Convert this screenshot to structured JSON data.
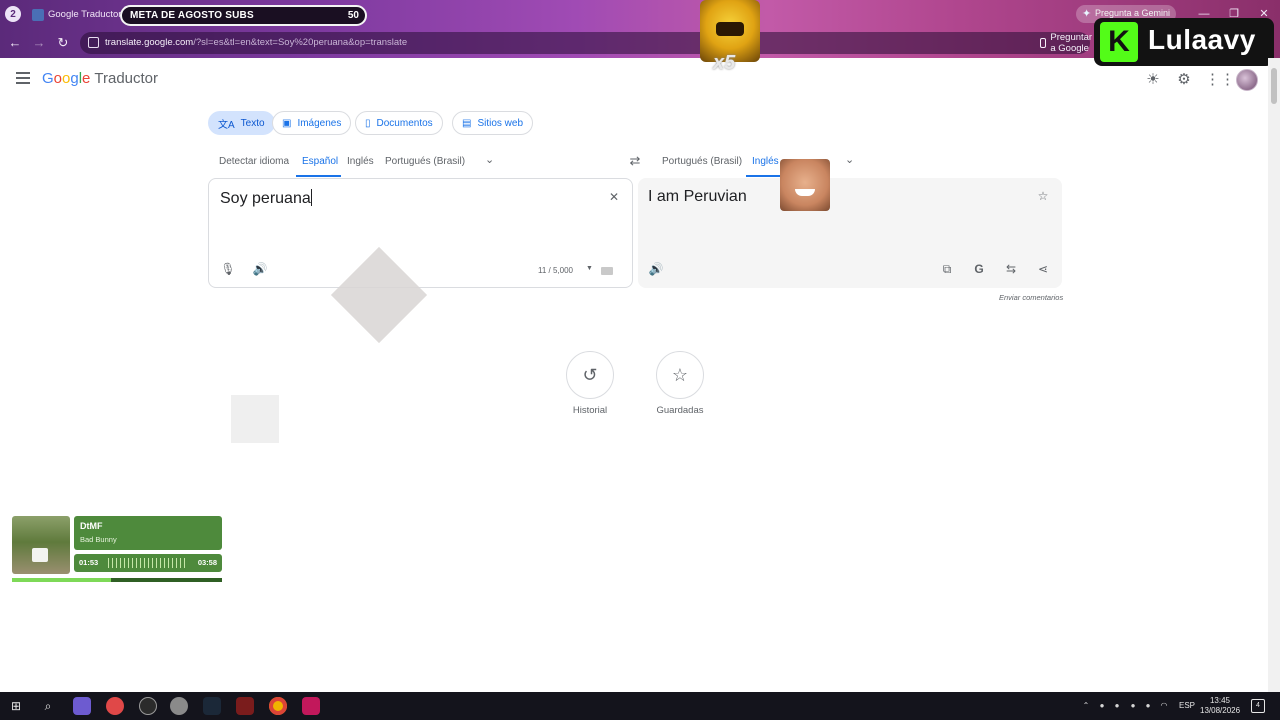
{
  "browser": {
    "tab_count": "2",
    "tab_title": "Google Traductor",
    "url_main": "translate.google.com",
    "url_rest": "/?sl=es&tl=en&text=Soy%20peruana&op=translate",
    "ask_google_label": "Preguntar a Google",
    "gemini_label": "Pregunta a Gemini"
  },
  "overlay": {
    "subgoal_label": "META DE AGOSTO SUBS",
    "subgoal_count": "50",
    "emote_multiplier": "x5",
    "logo_letter": "K",
    "logo_text": "Lulaavy"
  },
  "app": {
    "brand": {
      "g1": "G",
      "o1": "o",
      "o2": "o",
      "g2": "g",
      "l": "l",
      "e": "e"
    },
    "brand_sub": "Traductor"
  },
  "modes": [
    {
      "label": "Texto",
      "active": true
    },
    {
      "label": "Imágenes",
      "active": false
    },
    {
      "label": "Documentos",
      "active": false
    },
    {
      "label": "Sitios web",
      "active": false
    }
  ],
  "source_langs": [
    "Detectar idioma",
    "Español",
    "Inglés",
    "Portugués (Brasil)"
  ],
  "target_langs": [
    "Portugués (Brasil)",
    "Inglés"
  ],
  "source": {
    "text": "Soy peruana",
    "counter": "11 / 5,000"
  },
  "target": {
    "text": "I am Peruvian"
  },
  "feedback_label": "Enviar comentarios",
  "history_label": "Historial",
  "saved_label": "Guardadas",
  "music": {
    "title": "DtMF",
    "artist": "Bad Bunny",
    "elapsed": "01:53",
    "total": "03:58",
    "progress": 0.47
  },
  "taskbar": {
    "lang": "ESP",
    "time": "13:45",
    "date": "13/08/2026",
    "notifications": "4"
  },
  "colors": {
    "accent": "#1a73e8",
    "chip_active_bg": "#d3e3fd",
    "kick_green": "#53fc18",
    "music_green": "#4e8a3c"
  }
}
